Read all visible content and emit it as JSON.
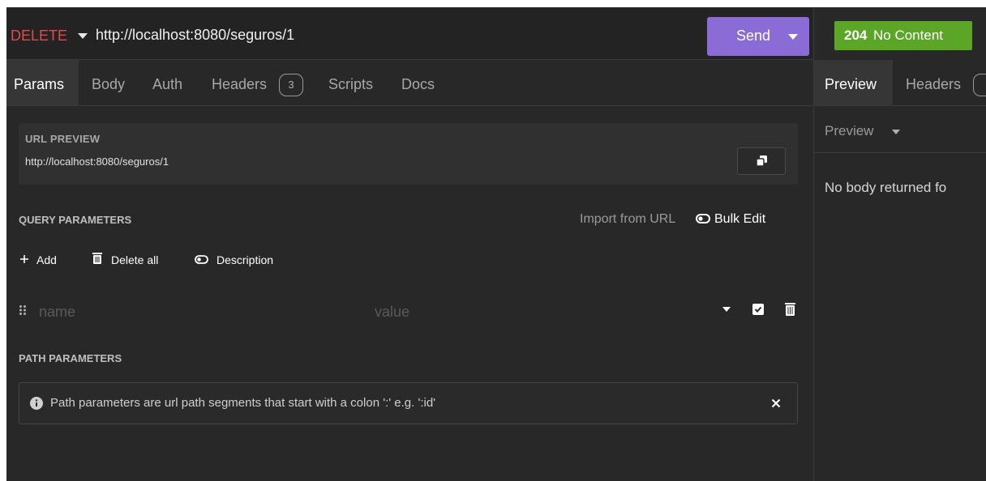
{
  "request": {
    "method": "DELETE",
    "url": "http://localhost:8080/seguros/1",
    "send_label": "Send",
    "method_color": "#e5484d",
    "send_color": "#8b6bd6"
  },
  "tabs": [
    {
      "label": "Params",
      "active": true
    },
    {
      "label": "Body"
    },
    {
      "label": "Auth"
    },
    {
      "label": "Headers",
      "badge": "3"
    },
    {
      "label": "Scripts"
    },
    {
      "label": "Docs"
    }
  ],
  "url_preview": {
    "label": "URL PREVIEW",
    "value": "http://localhost:8080/seguros/1",
    "copy_icon": "copy-icon"
  },
  "query": {
    "title": "QUERY PARAMETERS",
    "import_label": "Import from URL",
    "bulk_edit_label": "Bulk Edit",
    "add_label": "Add",
    "delete_all_label": "Delete all",
    "description_label": "Description",
    "row": {
      "name_placeholder": "name",
      "value_placeholder": "value"
    }
  },
  "path": {
    "title": "PATH PARAMETERS",
    "info": "Path parameters are url path segments that start with a colon ':' e.g. ':id'"
  },
  "response": {
    "status_code": "204",
    "status_text": "No Content",
    "status_color": "#5ca627",
    "tabs": [
      {
        "label": "Preview",
        "active": true
      },
      {
        "label": "Headers"
      }
    ],
    "preview_mode": "Preview",
    "empty_message": "No body returned fo"
  }
}
